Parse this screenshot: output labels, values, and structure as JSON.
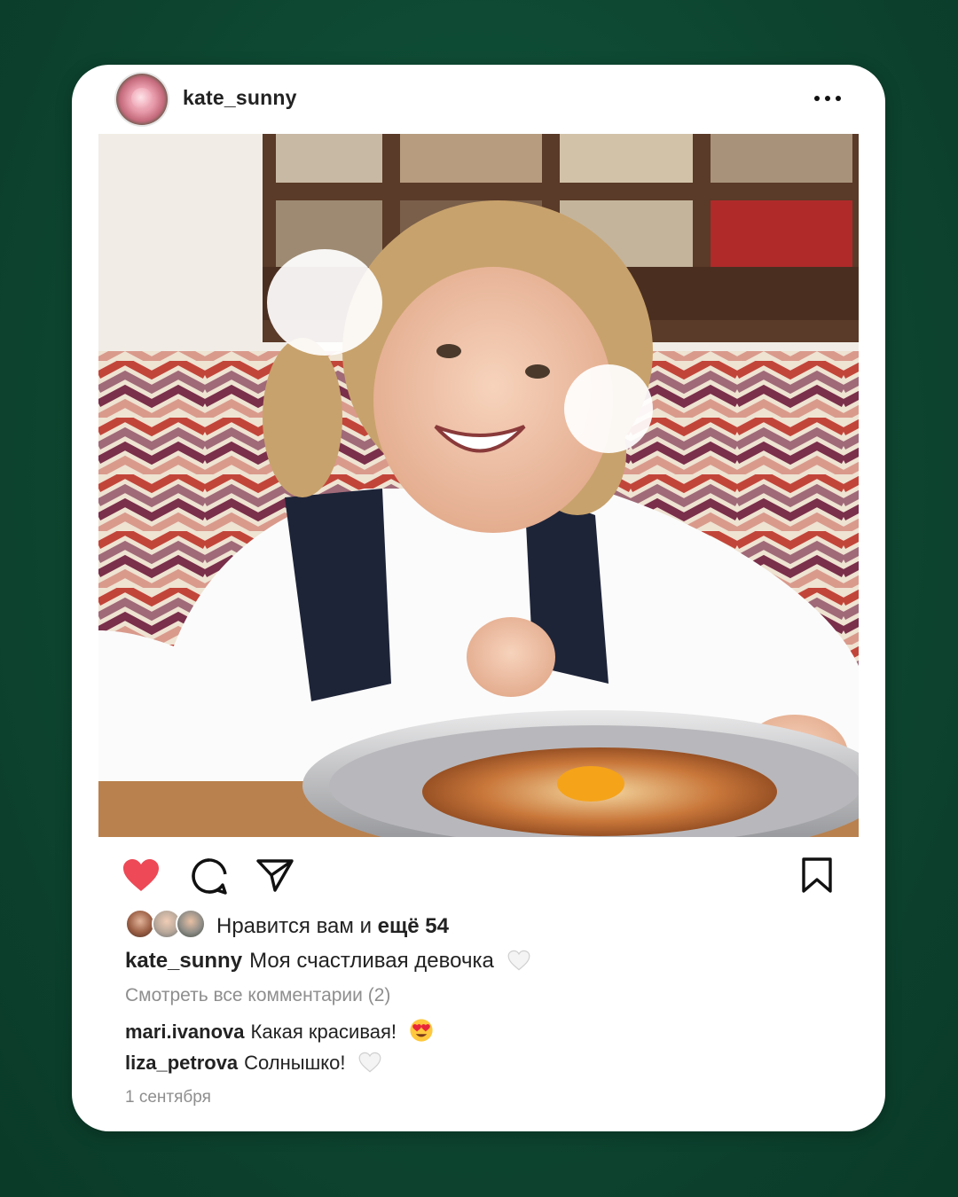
{
  "post": {
    "username": "kate_sunny",
    "caption": "Моя счастливая девочка",
    "caption_emoji": "white-heart-icon",
    "likes_prefix": "Нравится вам и",
    "likes_count": "ещё 54",
    "view_comments": "Смотреть все комментарии (2)",
    "comments": [
      {
        "user": "mari.ivanova",
        "text": "Какая красивая!",
        "emoji": "heart-eyes-emoji"
      },
      {
        "user": "liza_petrova",
        "text": "Солнышко!",
        "emoji": "white-heart-icon"
      }
    ],
    "date": "1 сентября",
    "liked": true
  },
  "colors": {
    "background": "#0e4a34",
    "like_red": "#ed4956",
    "muted_text": "#8e8e8e"
  },
  "icons": {
    "more": "more-dots-icon",
    "like": "heart-icon",
    "comment": "comment-bubble-icon",
    "share": "paper-plane-icon",
    "save": "bookmark-icon"
  }
}
